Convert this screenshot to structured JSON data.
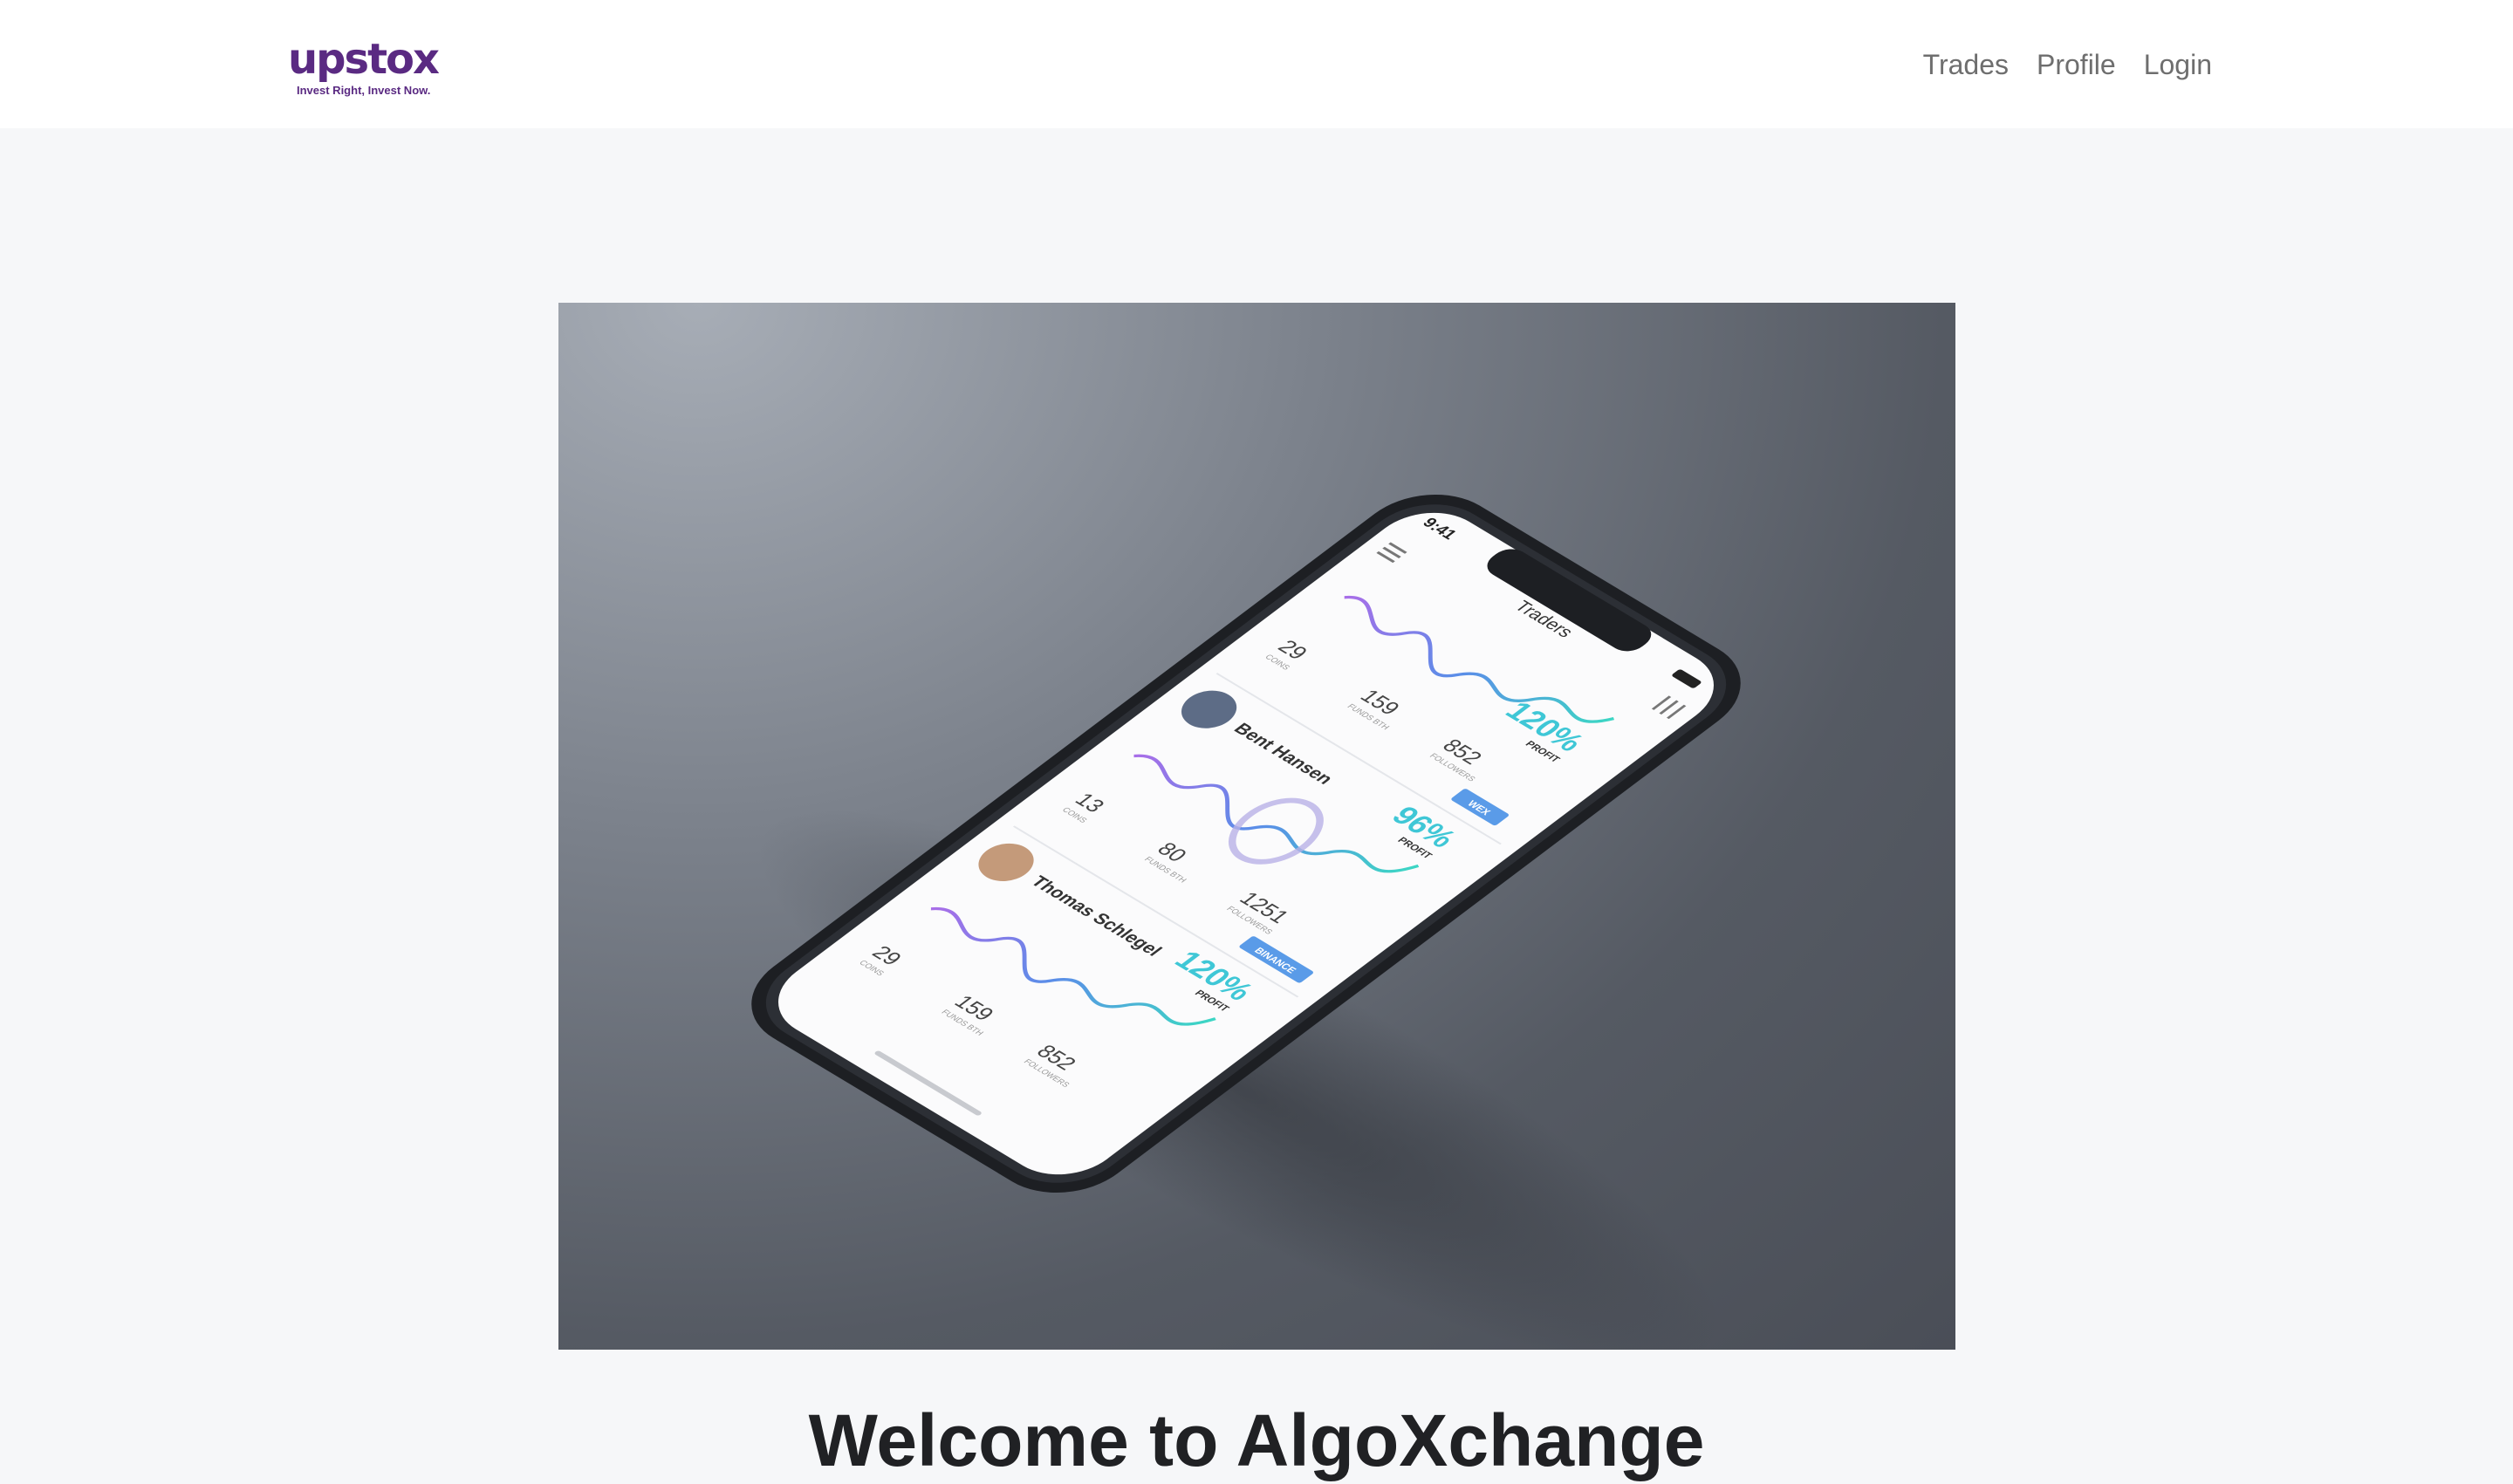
{
  "header": {
    "brand": {
      "name": "upstox",
      "tagline": "Invest Right, Invest Now.",
      "color": "#5a2a82"
    },
    "nav": [
      {
        "label": "Trades"
      },
      {
        "label": "Profile"
      },
      {
        "label": "Login"
      }
    ]
  },
  "hero_image": {
    "status_time": "9:41",
    "screen_title": "Traders",
    "traders": [
      {
        "name": "",
        "profit": "120%",
        "profit_label": "PROFIT",
        "stats": [
          {
            "value": "29",
            "label": "COINS"
          },
          {
            "value": "159",
            "label": "FUNDS BTH"
          },
          {
            "value": "852",
            "label": "FOLLOWERS"
          }
        ],
        "exchange": "WEX"
      },
      {
        "name": "Bent Hansen",
        "profit": "96%",
        "profit_label": "PROFIT",
        "stats": [
          {
            "value": "13",
            "label": "COINS"
          },
          {
            "value": "80",
            "label": "FUNDS BTH"
          },
          {
            "value": "1251",
            "label": "FOLLOWERS"
          }
        ],
        "exchange": "BINANCE"
      },
      {
        "name": "Thomas Schlegel",
        "profit": "120%",
        "profit_label": "PROFIT",
        "stats": [
          {
            "value": "29",
            "label": "COINS"
          },
          {
            "value": "159",
            "label": "FUNDS BTH"
          },
          {
            "value": "852",
            "label": "FOLLOWERS"
          }
        ]
      }
    ]
  },
  "main": {
    "welcome": "Welcome to AlgoXchange"
  }
}
